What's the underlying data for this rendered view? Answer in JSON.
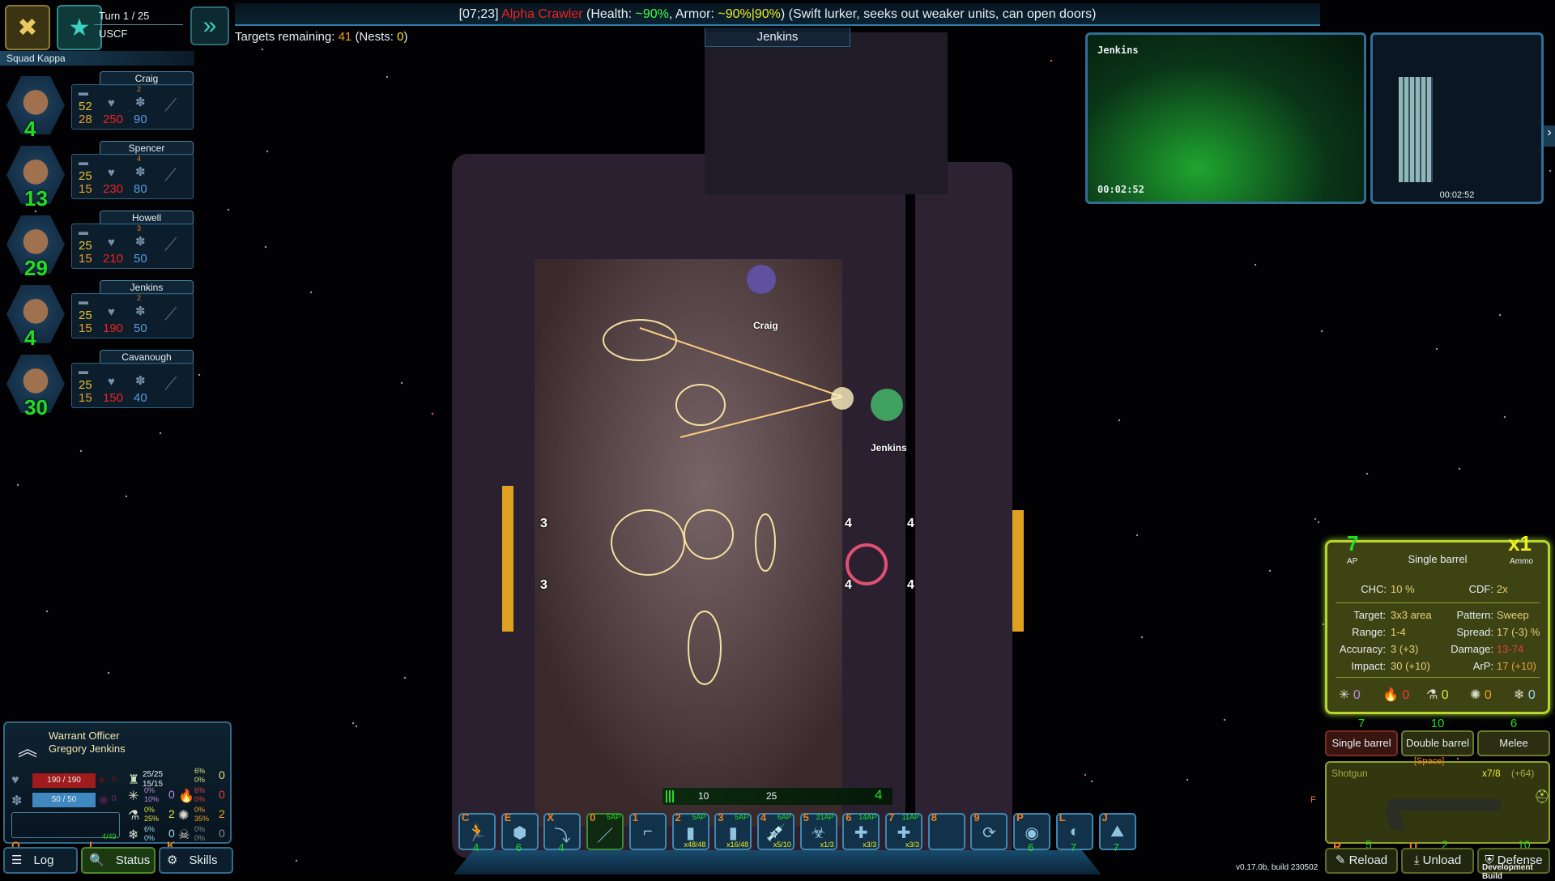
{
  "top": {
    "turn": "Turn 1 / 25",
    "faction": "USCF",
    "targets_label": "Targets remaining:",
    "targets": "41",
    "nests_label": "(Nests:",
    "nests": "0",
    "nests_close": ")",
    "selected_unit": "Jenkins"
  },
  "message": {
    "coords": "[07;23]",
    "enemy": "Alpha Crawler",
    "health_label": "(Health:",
    "health": "~90%",
    "armor_label": ", Armor:",
    "armor": "~90%|90%",
    "desc": ") (Swift lurker, seeks out weaker units, can open doors)"
  },
  "squad": {
    "name": "Squad Kappa",
    "members": [
      {
        "name": "Craig",
        "a": "52",
        "b": "28",
        "hp": "250",
        "armor": "90",
        "xp": "4",
        "badge": "2",
        "weapon": "axe"
      },
      {
        "name": "Spencer",
        "a": "25",
        "b": "15",
        "hp": "230",
        "armor": "80",
        "xp": "13",
        "badge": "4",
        "weapon": "launcher"
      },
      {
        "name": "Howell",
        "a": "25",
        "b": "15",
        "hp": "210",
        "armor": "50",
        "xp": "29",
        "badge": "3",
        "weapon": "rifle"
      },
      {
        "name": "Jenkins",
        "a": "25",
        "b": "15",
        "hp": "190",
        "armor": "50",
        "xp": "4",
        "badge": "2",
        "weapon": "shotgun"
      },
      {
        "name": "Cavanough",
        "a": "25",
        "b": "15",
        "hp": "150",
        "armor": "40",
        "xp": "30",
        "badge": "",
        "weapon": "smg"
      }
    ]
  },
  "camera": {
    "unit": "Jenkins",
    "time": "00:02:52",
    "minimap_time": "00:02:52"
  },
  "map": {
    "labels": [
      "Craig",
      "Jenkins"
    ],
    "door_numbers": [
      "3",
      "3"
    ],
    "numbers": [
      "4",
      "4",
      "4",
      "4"
    ]
  },
  "weapon": {
    "ap": "7",
    "ap_label": "AP",
    "ammo": "x1",
    "ammo_label": "Ammo",
    "mode": "Single barrel",
    "chc_label": "CHC:",
    "chc": "10 %",
    "cdf_label": "CDF:",
    "cdf": "2x",
    "left": [
      {
        "l": "Target:",
        "v": "3x3 area"
      },
      {
        "l": "Range:",
        "v": "1-4"
      },
      {
        "l": "Accuracy:",
        "v": "3 (+3)"
      },
      {
        "l": "Impact:",
        "v": "30 (+10)"
      }
    ],
    "right": [
      {
        "l": "Pattern:",
        "v": "Sweep"
      },
      {
        "l": "Spread:",
        "v": "17 (-3) %"
      },
      {
        "l": "Damage:",
        "v": "13-74"
      },
      {
        "l": "ArP:",
        "v": "17 (+10)"
      }
    ],
    "resists": [
      "0",
      "0",
      "0",
      "0",
      "0"
    ],
    "modes": [
      {
        "label": "Single barrel",
        "cost": "7"
      },
      {
        "label": "Double barrel",
        "cost": "10"
      },
      {
        "label": "Melee",
        "cost": "6"
      }
    ],
    "space_key": "[Space]",
    "name": "Shotgun",
    "ammo_count": "x7/8",
    "ammo_reserve": "(+64)",
    "f_key": "F",
    "actions": [
      {
        "label": "Reload",
        "key": "R",
        "cost": "5"
      },
      {
        "label": "Unload",
        "key": "U",
        "cost": "2"
      },
      {
        "label": "Defense",
        "key": "",
        "cost": "10"
      }
    ]
  },
  "unit": {
    "rank": "Warrant Officer",
    "name": "Gregory Jenkins",
    "hp": "190 / 190",
    "armor": "50 / 50",
    "bleed": "0",
    "poison": "0",
    "xp": "4/49",
    "carry": [
      "25/25",
      "15/15"
    ],
    "res": [
      {
        "a": "6%",
        "b": "0%",
        "v": "0"
      },
      {
        "a": "0%",
        "b": "10%",
        "v": "0"
      },
      {
        "a": "6%",
        "b": "0%",
        "v": "0"
      },
      {
        "a": "0%",
        "b": "25%",
        "v": "2"
      },
      {
        "a": "0%",
        "b": "35%",
        "v": "2"
      },
      {
        "a": "6%",
        "b": "0%",
        "v": "0"
      },
      {
        "a": "0%",
        "b": "0%",
        "v": "0"
      }
    ]
  },
  "bottom_buttons": [
    {
      "label": "Log",
      "key": "O"
    },
    {
      "label": "Status",
      "key": "I"
    },
    {
      "label": "Skills",
      "key": "K"
    }
  ],
  "timeline": {
    "a": "10",
    "b": "25",
    "ap": "4"
  },
  "hotbar": [
    {
      "k": "C",
      "n": "4",
      "g": "🏃"
    },
    {
      "k": "E",
      "n": "6",
      "g": "⬢"
    },
    {
      "k": "X",
      "n": "4",
      "g": "⤵"
    },
    {
      "k": "0",
      "ap": "5AP",
      "g": "／"
    },
    {
      "k": "1",
      "g": "⌐"
    },
    {
      "k": "2",
      "ap": "5AP",
      "q": "x48/48",
      "g": "▮"
    },
    {
      "k": "3",
      "ap": "5AP",
      "q": "x16/48",
      "g": "▮"
    },
    {
      "k": "4",
      "ap": "6AP",
      "q": "x5/10",
      "g": "💉"
    },
    {
      "k": "5",
      "ap": "21AP",
      "q": "x1/3",
      "g": "☣"
    },
    {
      "k": "6",
      "ap": "14AP",
      "q": "x3/3",
      "g": "✚"
    },
    {
      "k": "7",
      "ap": "11AP",
      "q": "x3/3",
      "g": "✚"
    },
    {
      "k": "8",
      "g": ""
    },
    {
      "k": "9",
      "g": "⟳"
    },
    {
      "k": "P",
      "n": "6",
      "g": "◉"
    },
    {
      "k": "L",
      "n": "7",
      "g": "◐"
    },
    {
      "k": "J",
      "n": "7",
      "g": "⛰"
    }
  ],
  "footer": {
    "version": "v0.17.0b, build 230502",
    "dev": "Development Build"
  },
  "colors": {
    "accent": "#2f6a8a",
    "weapon_panel": "#b9d430",
    "ap_green": "#22dd22",
    "enemy_red": "#ee2222"
  }
}
